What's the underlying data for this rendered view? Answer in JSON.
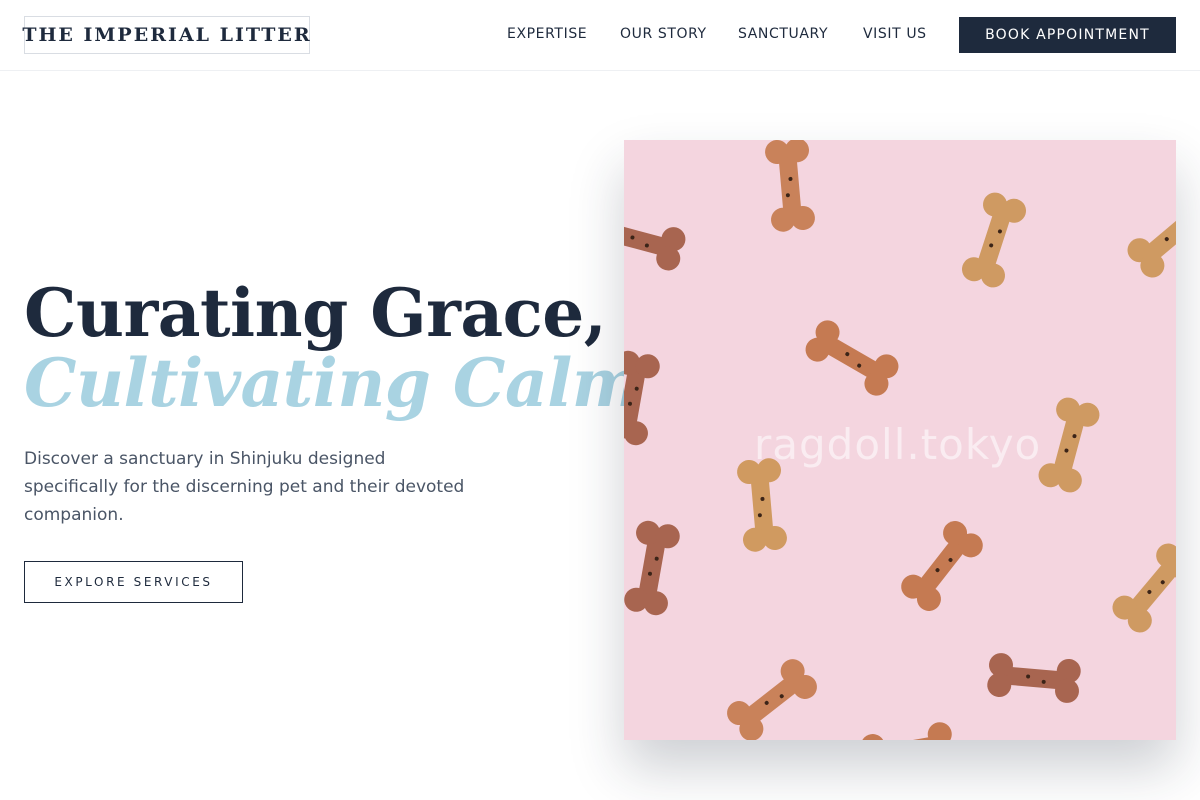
{
  "brand": {
    "logo_text": "THE IMPERIAL LITTER"
  },
  "nav": {
    "items": [
      {
        "label": "EXPERTISE"
      },
      {
        "label": "OUR STORY"
      },
      {
        "label": "SANCTUARY"
      },
      {
        "label": "VISIT US"
      }
    ],
    "cta_label": "BOOK APPOINTMENT"
  },
  "hero": {
    "title_line1": "Curating Grace,",
    "title_line2": "Cultivating Calm.",
    "description": "Discover a sanctuary in Shinjuku designed specifically for the discerning pet and their devoted companion.",
    "button_label": "EXPLORE SERVICES",
    "image": {
      "subject": "dog-bone-biscuits-on-pink-background",
      "watermark": "ragdoll.tokyo"
    }
  },
  "colors": {
    "navy": "#1e2a3d",
    "accent_blue": "#a9d3e2",
    "body_gray": "#4a5566",
    "image_pink": "#f4d5df"
  }
}
